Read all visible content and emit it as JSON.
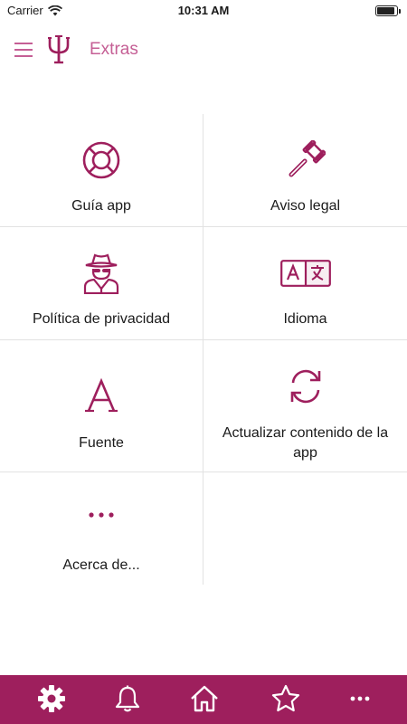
{
  "status_bar": {
    "carrier": "Carrier",
    "time": "10:31 AM",
    "battery_level": 0.9
  },
  "header": {
    "title": "Extras"
  },
  "grid": {
    "items": [
      {
        "label": "Guía app",
        "icon": "lifebuoy-icon"
      },
      {
        "label": "Aviso legal",
        "icon": "gavel-icon"
      },
      {
        "label": "Política de privacidad",
        "icon": "spy-icon"
      },
      {
        "label": "Idioma",
        "icon": "translate-icon"
      },
      {
        "label": "Fuente",
        "icon": "font-icon"
      },
      {
        "label": "Actualizar contenido de la app",
        "icon": "refresh-icon"
      },
      {
        "label": "Acerca de...",
        "icon": "more-icon"
      }
    ]
  },
  "tabbar": {
    "tabs": [
      "settings-icon",
      "bell-icon",
      "home-icon",
      "star-icon",
      "more-icon"
    ]
  },
  "colors": {
    "accent": "#9e1f5d",
    "title": "#c55f95",
    "background": "#ffffff",
    "divider": "#e2e2e2"
  }
}
